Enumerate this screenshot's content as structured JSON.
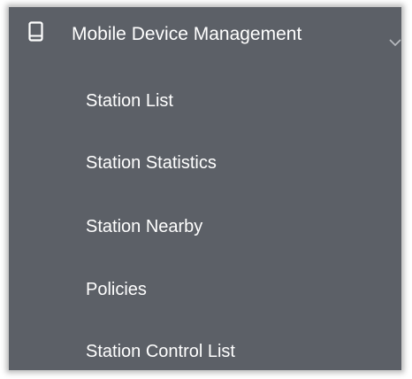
{
  "menu": {
    "header": {
      "label": "Mobile Device Management",
      "icon": "mobile-device-icon",
      "expand_icon": "chevron-down-icon",
      "expanded": true
    },
    "items": [
      {
        "label": "Station List"
      },
      {
        "label": "Station Statistics"
      },
      {
        "label": "Station Nearby"
      },
      {
        "label": "Policies"
      },
      {
        "label": "Station Control List"
      }
    ]
  },
  "colors": {
    "panel_background": "#5c6067",
    "text": "#ffffff",
    "chevron": "#b9bcc1"
  }
}
